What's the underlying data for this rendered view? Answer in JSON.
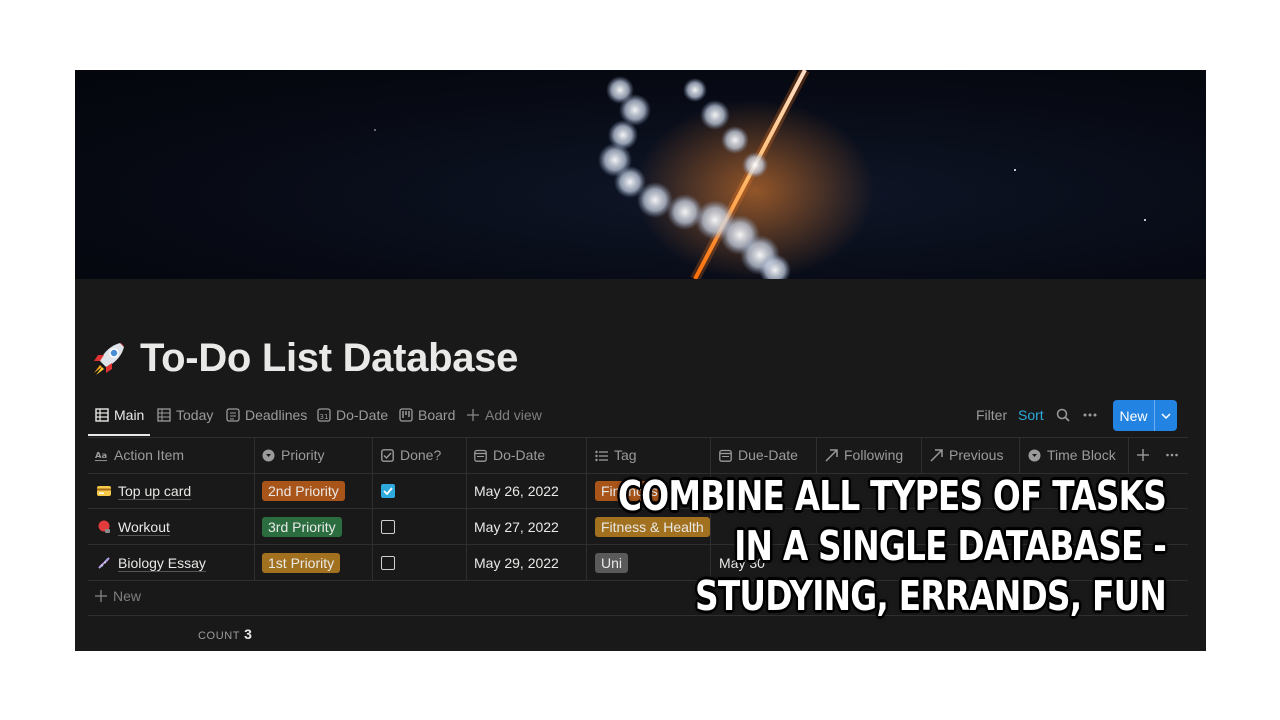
{
  "page": {
    "title": "To-Do List Database",
    "title_icon": "rocket-icon"
  },
  "views": [
    {
      "label": "Main",
      "icon": "table-icon",
      "active": true
    },
    {
      "label": "Today",
      "icon": "table-icon"
    },
    {
      "label": "Deadlines",
      "icon": "list-icon"
    },
    {
      "label": "Do-Date",
      "icon": "calendar-icon"
    },
    {
      "label": "Board",
      "icon": "board-icon"
    },
    {
      "label": "Add view",
      "icon": "plus-icon"
    }
  ],
  "toolbar": {
    "filter": "Filter",
    "sort": "Sort",
    "new": "New"
  },
  "columns": [
    {
      "label": "Action Item",
      "icon": "text-icon"
    },
    {
      "label": "Priority",
      "icon": "select-icon"
    },
    {
      "label": "Done?",
      "icon": "checkbox-icon"
    },
    {
      "label": "Do-Date",
      "icon": "date-icon"
    },
    {
      "label": "Tag",
      "icon": "multiselect-icon"
    },
    {
      "label": "Due-Date",
      "icon": "date-icon"
    },
    {
      "label": "Following",
      "icon": "relation-icon"
    },
    {
      "label": "Previous",
      "icon": "relation-icon"
    },
    {
      "label": "Time Block",
      "icon": "select-icon"
    }
  ],
  "rows": [
    {
      "icon": "credit-card-icon",
      "item": "Top up card",
      "priority": "2nd Priority",
      "done": true,
      "do_date": "May 26, 2022",
      "tag": "Finances",
      "due_date": ""
    },
    {
      "icon": "boxing-glove-icon",
      "item": "Workout",
      "priority": "3rd Priority",
      "done": false,
      "do_date": "May 27, 2022",
      "tag": "Fitness & Health",
      "due_date": ""
    },
    {
      "icon": "dna-icon",
      "item": "Biology Essay",
      "priority": "1st Priority",
      "done": false,
      "do_date": "May 29, 2022",
      "tag": "Uni",
      "due_date": "May 30"
    }
  ],
  "table_footer": {
    "new_row": "New",
    "count_label": "COUNT",
    "count_value": "3"
  },
  "colors": {
    "priority_2nd": "#a9551a",
    "priority_3rd": "#2b6d3e",
    "priority_1st": "#a1711f",
    "tag_finances": "#a9551a",
    "tag_fitness": "#a1711f",
    "tag_uni": "#5a5a5a",
    "accent": "#2383e2"
  },
  "overlay": {
    "line1": "COMBINE ALL TYPES OF TASKS",
    "line2": "IN A SINGLE DATABASE -",
    "line3": "STUDYING, ERRANDS, FUN"
  }
}
